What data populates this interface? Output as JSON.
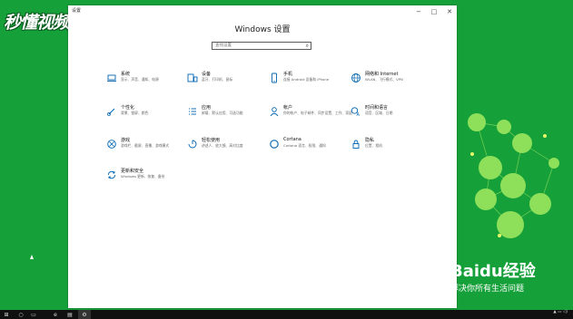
{
  "watermark": "秒懂视频",
  "window": {
    "title": "设置",
    "heading": "Windows 设置",
    "search_placeholder": "查找设置",
    "accent": "#0063b1"
  },
  "tiles": [
    {
      "title": "系统",
      "desc": "显示、声音、通知、电源",
      "icon": "laptop-icon"
    },
    {
      "title": "设备",
      "desc": "蓝牙、打印机、鼠标",
      "icon": "devices-icon"
    },
    {
      "title": "手机",
      "desc": "连接 Android 设备和 iPhone",
      "icon": "phone-icon"
    },
    {
      "title": "网络和 Internet",
      "desc": "WLAN、飞行模式、VPN",
      "icon": "globe-icon"
    },
    {
      "title": "个性化",
      "desc": "背景、锁屏、颜色",
      "icon": "paintbrush-icon"
    },
    {
      "title": "应用",
      "desc": "卸载、默认应用、可选功能",
      "icon": "apps-icon"
    },
    {
      "title": "帐户",
      "desc": "你的帐户、电子邮件、同步设置、工作、家庭",
      "icon": "person-icon"
    },
    {
      "title": "时间和语言",
      "desc": "语音、区域、日期",
      "icon": "time-language-icon"
    },
    {
      "title": "游戏",
      "desc": "游戏栏、截屏、直播、游戏模式",
      "icon": "xbox-icon"
    },
    {
      "title": "轻松使用",
      "desc": "讲述人、放大镜、高对比度",
      "icon": "ease-of-access-icon"
    },
    {
      "title": "Cortana",
      "desc": "Cortana 语言、权限、通知",
      "icon": "cortana-icon"
    },
    {
      "title": "隐私",
      "desc": "位置、相机",
      "icon": "lock-icon"
    },
    {
      "title": "更新和安全",
      "desc": "Windows 更新、恢复、备份",
      "icon": "update-icon"
    }
  ],
  "baidu": {
    "logo": "Baidu经验",
    "slogan": "解决你所有生活问题"
  }
}
